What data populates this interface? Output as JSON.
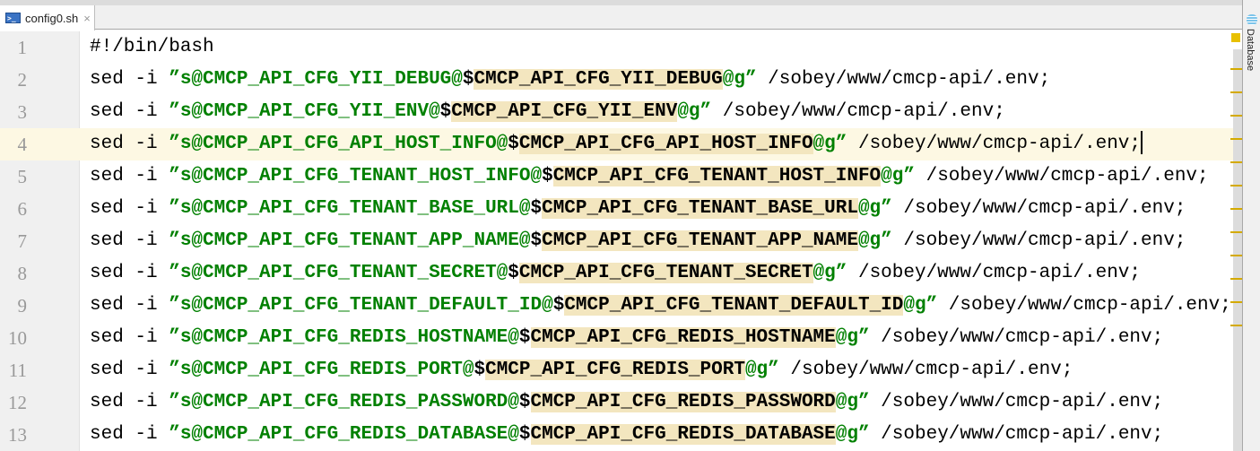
{
  "tab": {
    "title": "config0.sh",
    "close": "×",
    "icon": "terminal-icon"
  },
  "side_panel": {
    "label": "Database",
    "icon": "database-icon"
  },
  "editor": {
    "current_line": 4,
    "lines": [
      {
        "num": "1",
        "plain": "#!/bin/bash"
      },
      {
        "num": "2",
        "prefix": "sed -i ",
        "open": "”s@CMCP_API_CFG_YII_DEBUG@",
        "dollar": "$",
        "var": "CMCP_API_CFG_YII_DEBUG",
        "close": "@g”",
        "path": " /sobey/www/cmcp-api/.env;"
      },
      {
        "num": "3",
        "prefix": "sed -i ",
        "open": "”s@CMCP_API_CFG_YII_ENV@",
        "dollar": "$",
        "var": "CMCP_API_CFG_YII_ENV",
        "close": "@g”",
        "path": " /sobey/www/cmcp-api/.env;"
      },
      {
        "num": "4",
        "prefix": "sed -i ",
        "open": "”s@CMCP_API_CFG_API_HOST_INFO@",
        "dollar": "$",
        "var": "CMCP_API_CFG_API_HOST_INFO",
        "close": "@g”",
        "path": " /sobey/www/cmcp-api/.env;"
      },
      {
        "num": "5",
        "prefix": "sed -i ",
        "open": "”s@CMCP_API_CFG_TENANT_HOST_INFO@",
        "dollar": "$",
        "var": "CMCP_API_CFG_TENANT_HOST_INFO",
        "close": "@g”",
        "path": " /sobey/www/cmcp-api/.env;"
      },
      {
        "num": "6",
        "prefix": "sed -i ",
        "open": "”s@CMCP_API_CFG_TENANT_BASE_URL@",
        "dollar": "$",
        "var": "CMCP_API_CFG_TENANT_BASE_URL",
        "close": "@g”",
        "path": " /sobey/www/cmcp-api/.env;"
      },
      {
        "num": "7",
        "prefix": "sed -i ",
        "open": "”s@CMCP_API_CFG_TENANT_APP_NAME@",
        "dollar": "$",
        "var": "CMCP_API_CFG_TENANT_APP_NAME",
        "close": "@g”",
        "path": " /sobey/www/cmcp-api/.env;"
      },
      {
        "num": "8",
        "prefix": "sed -i ",
        "open": "”s@CMCP_API_CFG_TENANT_SECRET@",
        "dollar": "$",
        "var": "CMCP_API_CFG_TENANT_SECRET",
        "close": "@g”",
        "path": " /sobey/www/cmcp-api/.env;"
      },
      {
        "num": "9",
        "prefix": "sed -i ",
        "open": "”s@CMCP_API_CFG_TENANT_DEFAULT_ID@",
        "dollar": "$",
        "var": "CMCP_API_CFG_TENANT_DEFAULT_ID",
        "close": "@g”",
        "path": " /sobey/www/cmcp-api/.env;"
      },
      {
        "num": "10",
        "prefix": "sed -i ",
        "open": "”s@CMCP_API_CFG_REDIS_HOSTNAME@",
        "dollar": "$",
        "var": "CMCP_API_CFG_REDIS_HOSTNAME",
        "close": "@g”",
        "path": " /sobey/www/cmcp-api/.env;"
      },
      {
        "num": "11",
        "prefix": "sed -i ",
        "open": "”s@CMCP_API_CFG_REDIS_PORT@",
        "dollar": "$",
        "var": "CMCP_API_CFG_REDIS_PORT",
        "close": "@g”",
        "path": " /sobey/www/cmcp-api/.env;"
      },
      {
        "num": "12",
        "prefix": "sed -i ",
        "open": "”s@CMCP_API_CFG_REDIS_PASSWORD@",
        "dollar": "$",
        "var": "CMCP_API_CFG_REDIS_PASSWORD",
        "close": "@g”",
        "path": " /sobey/www/cmcp-api/.env;"
      },
      {
        "num": "13",
        "prefix": "sed -i ",
        "open": "”s@CMCP_API_CFG_REDIS_DATABASE@",
        "dollar": "$",
        "var": "CMCP_API_CFG_REDIS_DATABASE",
        "close": "@g”",
        "path": " /sobey/www/cmcp-api/.env;"
      }
    ]
  }
}
